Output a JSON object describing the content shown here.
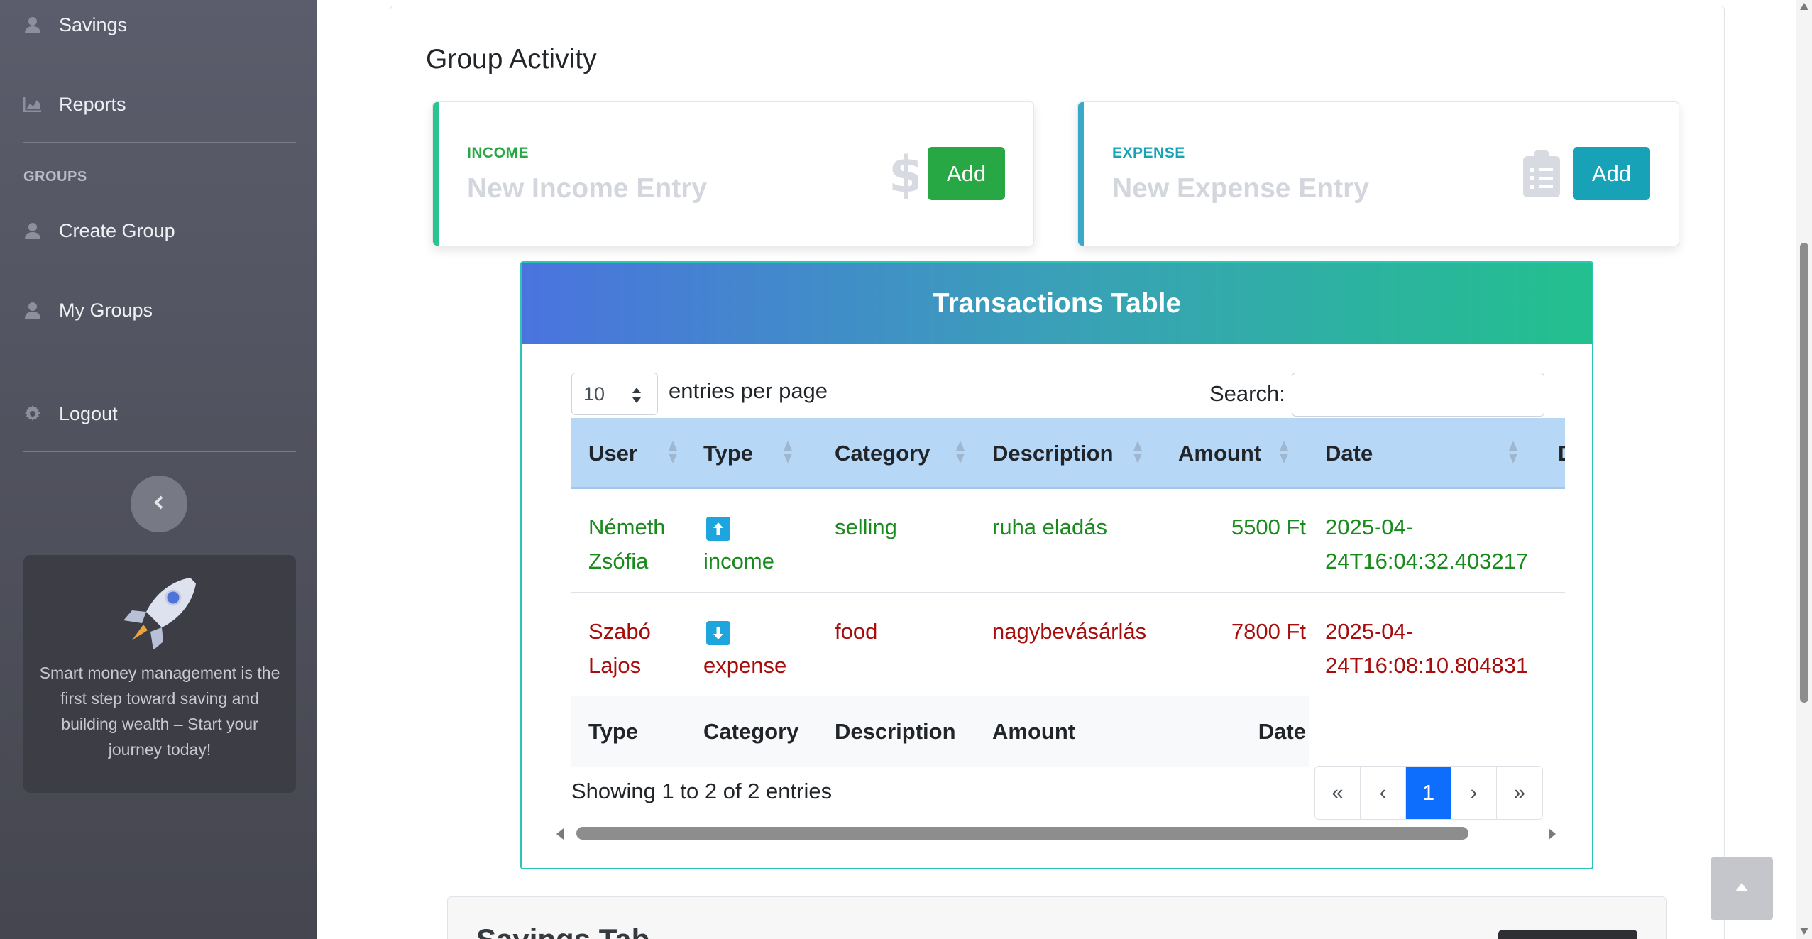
{
  "sidebar": {
    "items": [
      {
        "label": "Savings",
        "icon": "user-icon"
      },
      {
        "label": "Reports",
        "icon": "chart-area-icon"
      },
      {
        "label": "Create Group",
        "icon": "user-icon"
      },
      {
        "label": "My Groups",
        "icon": "user-icon"
      },
      {
        "label": "Logout",
        "icon": "gear-icon"
      }
    ],
    "groups_heading": "GROUPS",
    "collapse_icon": "chevron-left-icon",
    "promo_text": "Smart money management is the first step toward saving and building wealth – Start your journey today!"
  },
  "page": {
    "title": "Group Activity"
  },
  "income_card": {
    "kind": "INCOME",
    "headline": "New Income Entry",
    "icon": "dollar-icon",
    "button": "Add",
    "color": "#28a745"
  },
  "expense_card": {
    "kind": "EXPENSE",
    "headline": "New Expense Entry",
    "icon": "clipboard-list-icon",
    "button": "Add",
    "color": "#17a2b8"
  },
  "transactions": {
    "title": "Transactions Table",
    "page_length": "10",
    "length_label": "entries per page",
    "search_label": "Search:",
    "search_value": "",
    "columns": [
      "User",
      "Type",
      "Category",
      "Description",
      "Amount",
      "Date",
      "D"
    ],
    "rows": [
      {
        "user_first": "Németh",
        "user_last": "Zsófia",
        "type": "income",
        "type_icon": "arrow-up-icon",
        "category": "selling",
        "description": "ruha eladás",
        "amount": "5500 Ft",
        "date_line1": "2025-04-",
        "date_line2": "24T16:04:32.403217",
        "color": "#198a1c"
      },
      {
        "user_first": "Szabó",
        "user_last": "Lajos",
        "type": "expense",
        "type_icon": "arrow-down-icon",
        "category": "food",
        "description": "nagybevásárlás",
        "amount": "7800 Ft",
        "date_line1": "2025-04-",
        "date_line2": "24T16:08:10.804831",
        "color": "#a80d0d"
      }
    ],
    "footer_columns": [
      "Type",
      "Category",
      "Description",
      "Amount",
      "Date"
    ],
    "info": "Showing 1 to 2 of 2 entries",
    "pagination": [
      "«",
      "‹",
      "1",
      "›",
      "»"
    ],
    "active_page": "1"
  },
  "savings_section": {
    "title": "Savings Tab"
  },
  "back_to_top_icon": "arrow-up-icon"
}
